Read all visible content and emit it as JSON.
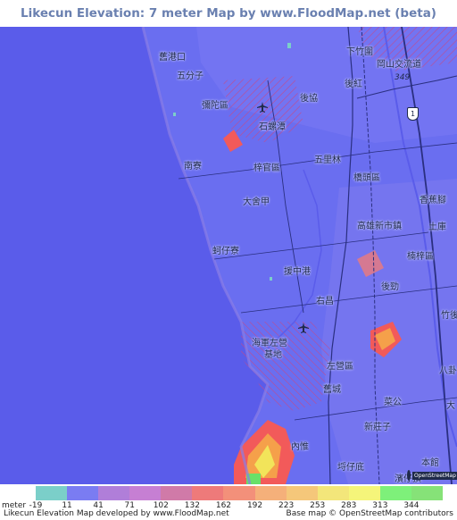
{
  "title": "Likecun Elevation: 7 meter Map by www.FloodMap.net (beta)",
  "map": {
    "places": [
      {
        "id": "xiazhuyuan",
        "label": "下竹圍"
      },
      {
        "id": "jiugangkou",
        "label": "舊港口"
      },
      {
        "id": "wufenzi",
        "label": "五分子"
      },
      {
        "id": "houxie",
        "label": "後協"
      },
      {
        "id": "houhong",
        "label": "後紅"
      },
      {
        "id": "mituo",
        "label": "彌陀區"
      },
      {
        "id": "shiluotan",
        "label": "石螺潭"
      },
      {
        "id": "nanliao",
        "label": "南寮"
      },
      {
        "id": "ziguan",
        "label": "梓官區"
      },
      {
        "id": "wulilin",
        "label": "五里林"
      },
      {
        "id": "qiaotou",
        "label": "橋頭區"
      },
      {
        "id": "dashejia",
        "label": "大舍甲"
      },
      {
        "id": "xiangjiaojiao",
        "label": "香蕉腳"
      },
      {
        "id": "gaoxiong_newtown",
        "label": "高雄新市鎮"
      },
      {
        "id": "tuku",
        "label": "土庫"
      },
      {
        "id": "dianzailiao",
        "label": "蚵仔寮"
      },
      {
        "id": "nanzi",
        "label": "楠梓區"
      },
      {
        "id": "yuanzhonggang",
        "label": "援中港"
      },
      {
        "id": "houjin",
        "label": "後勁"
      },
      {
        "id": "youchang",
        "label": "右昌"
      },
      {
        "id": "zhuhou",
        "label": "竹後"
      },
      {
        "id": "navy_base_1",
        "label": "海軍左營"
      },
      {
        "id": "navy_base_2",
        "label": "基地"
      },
      {
        "id": "zuoying",
        "label": "左營區"
      },
      {
        "id": "bagua",
        "label": "八卦"
      },
      {
        "id": "jiucheng",
        "label": "舊城"
      },
      {
        "id": "caigong",
        "label": "菜公"
      },
      {
        "id": "da",
        "label": "大"
      },
      {
        "id": "xinzhuangzi",
        "label": "新莊子"
      },
      {
        "id": "neiwei",
        "label": "內惟"
      },
      {
        "id": "benguan",
        "label": "本館"
      },
      {
        "id": "kezaidi",
        "label": "埒仔底"
      },
      {
        "id": "binzaiding",
        "label": "濱仔頂"
      },
      {
        "id": "gangshan_interchange",
        "label": "岡山交流道"
      }
    ],
    "road_labels": [
      {
        "id": "road_349",
        "label": "349"
      }
    ],
    "shields": [
      {
        "id": "freeway_1",
        "label": "1"
      }
    ],
    "colors": {
      "sea": "#5a5cea",
      "lowland": "#6a6ef0",
      "low_mid": "#8a7ee6",
      "hatch": "#c24a8a",
      "hill_red": "#f25a5a",
      "hill_orange": "#f5a04a",
      "hill_yellow": "#f2e45a",
      "hill_green": "#68e068"
    }
  },
  "legend": {
    "unit_label": "meter",
    "values": [
      "-19",
      "11",
      "41",
      "71",
      "102",
      "132",
      "162",
      "192",
      "223",
      "253",
      "283",
      "313",
      "344"
    ],
    "colors": [
      "#7bcfc9",
      "#7a7cf2",
      "#b07ed9",
      "#c67fd3",
      "#d07aa8",
      "#ee7a7a",
      "#f3907a",
      "#f5b07a",
      "#f5c77a",
      "#f3e67a",
      "#f5f57a",
      "#7ef07a",
      "#86e278"
    ]
  },
  "footer": {
    "left": "Likecun Elevation Map developed by www.FloodMap.net",
    "right": "Base map © OpenStreetMap contributors"
  },
  "attribution_logo": {
    "icon": "openstreetmap-logo-icon",
    "label": "OpenStreetMap"
  }
}
